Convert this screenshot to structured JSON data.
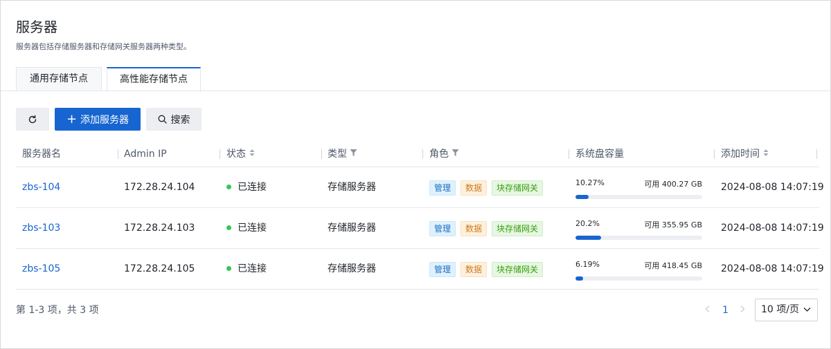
{
  "header": {
    "title": "服务器",
    "description": "服务器包括存储服务器和存储网关服务器两种类型。"
  },
  "tabs": [
    {
      "label": "通用存储节点",
      "active": false
    },
    {
      "label": "高性能存储节点",
      "active": true
    }
  ],
  "toolbar": {
    "refresh_icon": "refresh-icon",
    "add_label": "添加服务器",
    "search_label": "搜索"
  },
  "table": {
    "columns": [
      "服务器名",
      "Admin IP",
      "状态",
      "类型",
      "角色",
      "系统盘容量",
      "添加时间"
    ],
    "rows": [
      {
        "name": "zbs-104",
        "ip": "172.28.24.104",
        "status": "已连接",
        "type": "存储服务器",
        "roles": [
          "管理",
          "数据",
          "块存储网关"
        ],
        "cap_pct": "10.27%",
        "cap_free": "可用 400.27 GB",
        "cap_value": 10.27,
        "added": "2024-08-08 14:07:19"
      },
      {
        "name": "zbs-103",
        "ip": "172.28.24.103",
        "status": "已连接",
        "type": "存储服务器",
        "roles": [
          "管理",
          "数据",
          "块存储网关"
        ],
        "cap_pct": "20.2%",
        "cap_free": "可用 355.95 GB",
        "cap_value": 20.2,
        "added": "2024-08-08 14:07:19"
      },
      {
        "name": "zbs-105",
        "ip": "172.28.24.105",
        "status": "已连接",
        "type": "存储服务器",
        "roles": [
          "管理",
          "数据",
          "块存储网关"
        ],
        "cap_pct": "6.19%",
        "cap_free": "可用 418.45 GB",
        "cap_value": 6.19,
        "added": "2024-08-08 14:07:19"
      }
    ]
  },
  "pagination": {
    "summary": "第 1-3 项，共 3 项",
    "current_page": "1",
    "page_size": "10 项/页"
  },
  "colors": {
    "primary": "#1765d1",
    "status_connected": "#34c759"
  }
}
